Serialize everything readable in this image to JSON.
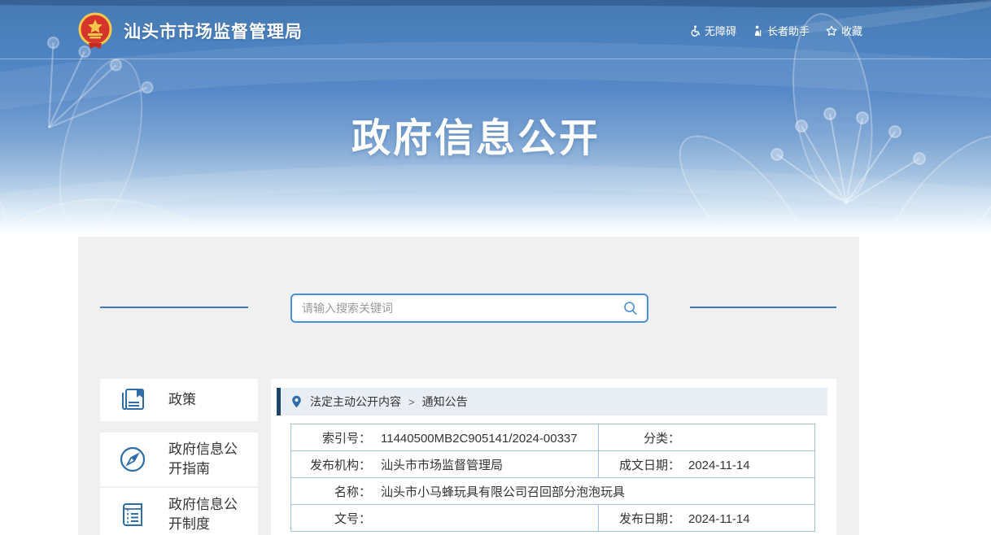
{
  "header": {
    "site_name": "汕头市市场监督管理局",
    "links": [
      {
        "label": "无障碍",
        "icon": "accessibility-icon"
      },
      {
        "label": "长者助手",
        "icon": "elder-assist-icon"
      },
      {
        "label": "收藏",
        "icon": "star-icon"
      }
    ]
  },
  "banner": {
    "title": "政府信息公开"
  },
  "search": {
    "placeholder": "请输入搜索关键词"
  },
  "sidebar": {
    "items": [
      {
        "label": "政策",
        "icon": "policy-book-icon"
      },
      {
        "label": "政府信息公开指南",
        "icon": "compass-icon"
      },
      {
        "label": "政府信息公开制度",
        "icon": "rules-notebook-icon"
      }
    ]
  },
  "breadcrumb": {
    "items": [
      "法定主动公开内容",
      "通知公告"
    ],
    "separator": ">"
  },
  "detail_table": {
    "rows": [
      [
        {
          "label": "索引号：",
          "value": "11440500MB2C905141/2024-00337"
        },
        {
          "label": "分类：",
          "value": ""
        }
      ],
      [
        {
          "label": "发布机构：",
          "value": "汕头市市场监督管理局"
        },
        {
          "label": "成文日期：",
          "value": "2024-11-14"
        }
      ],
      [
        {
          "label": "名称：",
          "value": "汕头市小马蜂玩具有限公司召回部分泡泡玩具"
        }
      ],
      [
        {
          "label": "文号：",
          "value": ""
        },
        {
          "label": "发布日期：",
          "value": "2024-11-14"
        }
      ]
    ]
  },
  "colors": {
    "banner_blue": "#4c82c0",
    "crumb_stripe": "#1e4567",
    "crumb_bg": "#e9eef4",
    "table_border": "#a3c0de",
    "icon_blue": "#2f6ca8",
    "search_border": "#4a90d9",
    "card_bg": "#f0f0f1"
  }
}
